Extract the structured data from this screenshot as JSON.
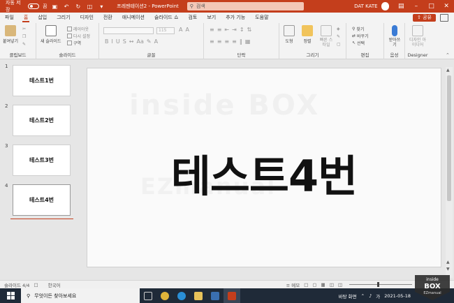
{
  "titlebar": {
    "autosave_label": "자동 저장",
    "autosave_state": "끔",
    "doc_title": "프레젠테이션2 - PowerPoint",
    "search_placeholder": "검색",
    "user_name": "DAT KATE",
    "accent_color": "#c43e1c"
  },
  "menu": {
    "tabs": [
      "파일",
      "홈",
      "삽입",
      "그리기",
      "디자인",
      "전환",
      "애니메이션",
      "슬라이드 쇼",
      "검토",
      "보기",
      "추가 기능",
      "도움말"
    ],
    "active_tab": "홈",
    "share_label": "공유"
  },
  "ribbon": {
    "clipboard": {
      "label": "클립보드",
      "paste": "붙여넣기"
    },
    "slides": {
      "label": "슬라이드",
      "new_slide": "새 슬라이드",
      "layout": "레이아웃",
      "reset": "다시 설정",
      "section": "구역"
    },
    "font": {
      "label": "글꼴",
      "size": "115"
    },
    "paragraph": {
      "label": "단락"
    },
    "drawing": {
      "label": "그리기",
      "shapes": "도형",
      "arrange": "정렬",
      "quick_styles": "빠른 스타일"
    },
    "editing": {
      "label": "편집",
      "find": "찾기",
      "replace": "바꾸기",
      "select": "선택"
    },
    "voice": {
      "label": "음성",
      "dictate": "받아쓰기"
    },
    "designer": {
      "label": "Designer",
      "design_ideas": "디자인 아이디어"
    }
  },
  "slides": [
    {
      "num": "1",
      "text": "테스트1번"
    },
    {
      "num": "2",
      "text": "테스트2번"
    },
    {
      "num": "3",
      "text": "테스트3번"
    },
    {
      "num": "4",
      "text": "테스트4번"
    }
  ],
  "current_slide": {
    "title": "테스트4번",
    "watermark_top": "inside BOX",
    "watermark_bottom": "EZmanual"
  },
  "statusbar": {
    "slide_count": "슬라이드 4/4",
    "language": "한국어",
    "notes": "메모"
  },
  "taskbar": {
    "search_placeholder": "무엇이든 찾아보세요",
    "tray_label": "바탕 화면",
    "date": "2021-05-18"
  },
  "overlay_logo": {
    "line1": "inside",
    "line2": "BOX",
    "line3": "EZmanual"
  }
}
